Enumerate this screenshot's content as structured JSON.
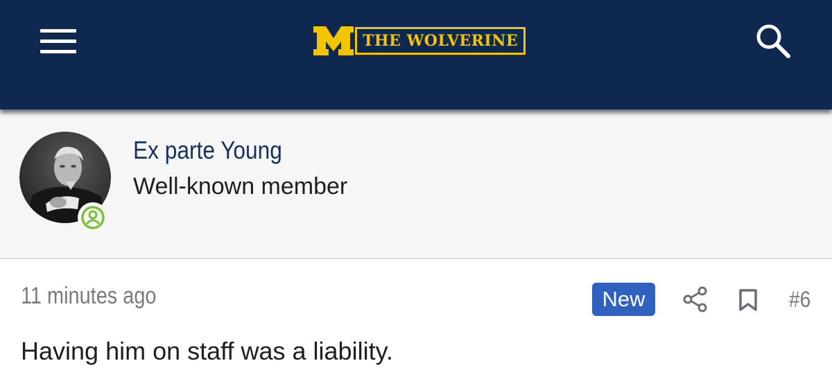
{
  "header": {
    "logo_letter": "M",
    "logo_text": "THE WOLVERINE",
    "background_color": "#0e284f",
    "accent_color": "#f3c400",
    "icons": [
      "menu-icon",
      "search-icon"
    ]
  },
  "member": {
    "username": "Ex parte Young",
    "title": "Well-known member",
    "status_icon": "online-user-icon",
    "status_color": "#7cbf3a"
  },
  "post": {
    "timestamp": "11 minutes ago",
    "badge": "New",
    "badge_color": "#2f62c0",
    "number": "#6",
    "body": "Having him on staff was a liability.",
    "actions": [
      "share-icon",
      "bookmark-icon"
    ]
  }
}
